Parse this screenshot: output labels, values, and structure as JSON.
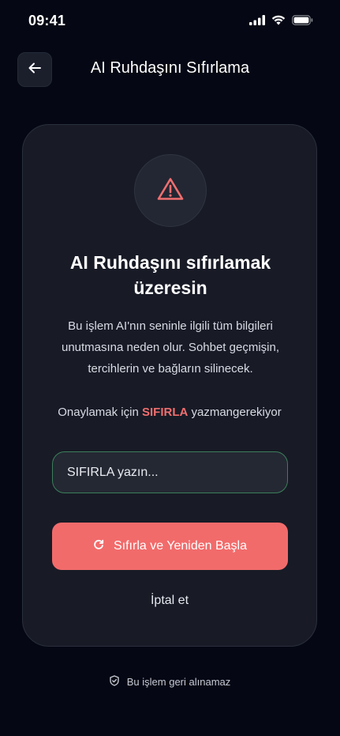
{
  "status_bar": {
    "time": "09:41",
    "icons": [
      "signal-icon",
      "wifi-icon",
      "battery-icon"
    ]
  },
  "header": {
    "back_icon": "arrow-left-icon",
    "title": "AI Ruhdaşını Sıfırlama"
  },
  "card": {
    "warning_icon": "warning-triangle-icon",
    "title_line1": "AI Ruhdaşını sıfırlamak",
    "title_line2": "üzeresin",
    "desc_line1": "Bu işlem AI'nın seninle ilgili tüm bilgileri",
    "desc_line2": "unutmasına neden olur. Sohbet geçmişin,",
    "desc_line3": "tercihlerin ve bağların silinecek.",
    "confirm_prefix": "Onaylamak için",
    "confirm_keyword": "SIFIRLA",
    "confirm_suffix": "yazmangerekiyor",
    "input_value": "",
    "input_placeholder": "SIFIRLA yazın...",
    "reset_button_label": "Sıfırla ve Yeniden Başla",
    "reset_button_icon": "refresh-icon",
    "cancel_label": "İptal et"
  },
  "footer": {
    "note_icon": "shield-check-icon",
    "note": "Bu işlem geri alınamaz"
  },
  "colors": {
    "background": "#050814",
    "card": "#181b26",
    "accent_red": "#f26b6b",
    "input_border": "#3c7f5b"
  }
}
